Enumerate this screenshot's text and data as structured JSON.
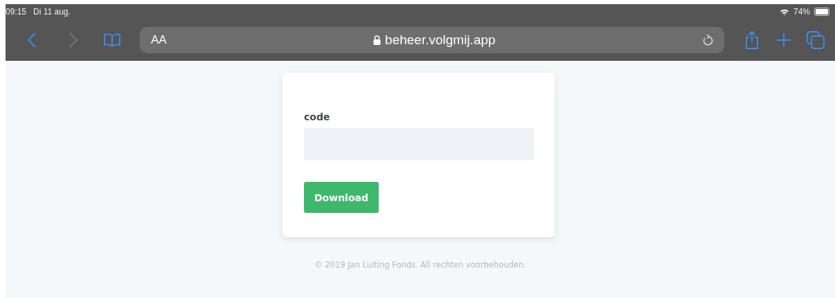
{
  "status_bar": {
    "time": "09:15",
    "date": "Di 11 aug.",
    "battery": "74%"
  },
  "browser": {
    "text_size": "AA",
    "url": "beheer.volgmij.app",
    "secure": true,
    "back_enabled": true,
    "forward_enabled": false
  },
  "form": {
    "label": "code",
    "button": "Download"
  },
  "footer": "© 2019 Jan Luiting Fonds. All rechten voorbehouden."
}
